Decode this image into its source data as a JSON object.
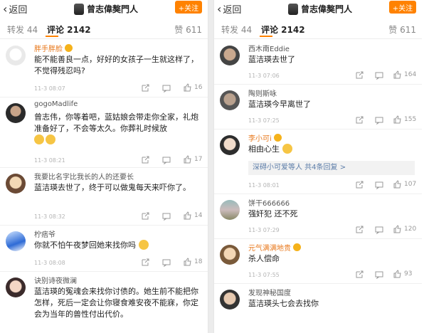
{
  "left": {
    "back_label": "返回",
    "title": "曾志偉獒門人",
    "follow_label": "+关注",
    "tabs": {
      "repost": "转发 44",
      "comments": "评论 2142",
      "likes": "赞 611"
    },
    "comments": [
      {
        "name": "胖手胖脸",
        "text": "能不能善良一点，好好的女孩子一生就这样了，不觉得残忍吗?",
        "time": "11-3 08:07",
        "likes": "16"
      },
      {
        "name": "gogoMadlife",
        "text": "曾志伟，你等着吧，蓝姑娘会带走你全家，礼炮准备好了，不会等太久。你葬礼时候放",
        "time": "11-3 08:21",
        "likes": "17"
      },
      {
        "name": "我要比名字比我长的人的还要长",
        "text": "蓝洁瑛去世了，终于可以做鬼每天来吓你了。",
        "time": "11-3 08:32",
        "likes": "14"
      },
      {
        "name": "柠痞爷",
        "text": "你就不怕午夜梦回她来找你吗",
        "time": "11-3 08:08",
        "likes": "18"
      },
      {
        "name": "诀别诗夜微澜",
        "text": "蓝洁瑛的冤魂会来找你讨债的。她生前不能把你怎样，死后一定会让你寝食难安夜不能寐，你定会为当年的兽性付出代价。",
        "time": "",
        "likes": ""
      }
    ]
  },
  "right": {
    "back_label": "返回",
    "title": "曾志偉獒門人",
    "follow_label": "+关注",
    "tabs": {
      "repost": "转发 44",
      "comments": "评论 2142",
      "likes": "赞 611"
    },
    "comments": [
      {
        "name": "西木南Eddie",
        "text": "蓝洁瑛去世了",
        "time": "11-3 07:06",
        "likes": "164"
      },
      {
        "name": "陶则斯咏",
        "text": "蓝洁瑛今早离世了",
        "time": "11-3 07:25",
        "likes": "155"
      },
      {
        "name": "李小可i",
        "text": "相由心生",
        "time": "11-3 08:01",
        "likes": "107",
        "reply": "深碍小可爱等人 共4条回复 >"
      },
      {
        "name": "饼干666666",
        "text": "强奸犯 还不死",
        "time": "11-3 07:29",
        "likes": "120"
      },
      {
        "name": "元气满满地贵",
        "text": "杀人偿命",
        "time": "11-3 07:55",
        "likes": "93"
      },
      {
        "name": "发现神秘国度",
        "text": "蓝洁瑛头七会去找你",
        "time": "",
        "likes": ""
      }
    ]
  },
  "colors": {
    "accent": "#ff8200",
    "link": "#5b7ca8",
    "orange_name": "#e8781c"
  }
}
